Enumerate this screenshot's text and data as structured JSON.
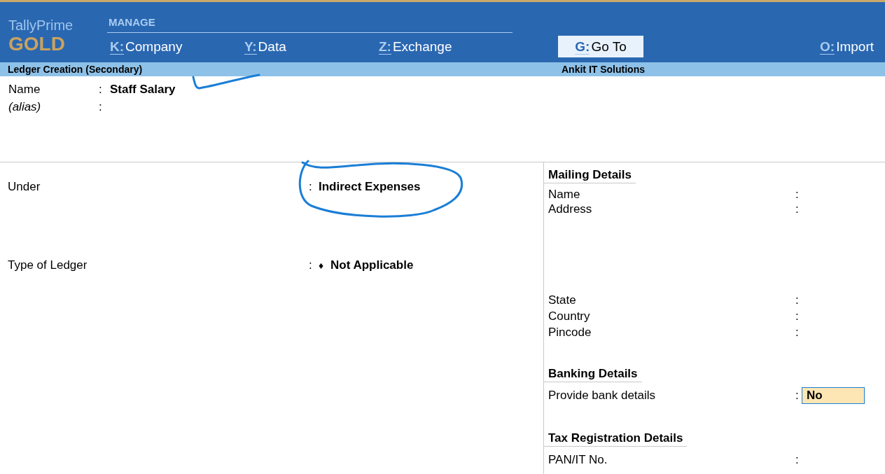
{
  "brand": {
    "product": "TallyPrime",
    "edition": "GOLD"
  },
  "menu": {
    "title": "MANAGE",
    "items": [
      {
        "key": "K:",
        "label": "Company",
        "selected": false
      },
      {
        "key": "Y:",
        "label": "Data",
        "selected": false
      },
      {
        "key": "Z:",
        "label": "Exchange",
        "selected": false
      },
      {
        "key": "G:",
        "label": "Go To",
        "selected": true
      },
      {
        "key": "O:",
        "label": "Import",
        "selected": false
      }
    ]
  },
  "subtitle_bar": {
    "screen": "Ledger Creation (Secondary)",
    "company": "Ankit IT Solutions"
  },
  "header_fields": [
    {
      "label": "Name",
      "italic": false,
      "separator": ":",
      "value": "Staff Salary"
    },
    {
      "label": "(alias)",
      "italic": true,
      "separator": ":"
    }
  ],
  "left_fields": [
    {
      "label": "Under",
      "separator": ":",
      "value": "Indirect Expenses"
    },
    {
      "label": "Type of Ledger",
      "separator": ":",
      "marker": "♦",
      "value": "Not Applicable"
    }
  ],
  "sections": [
    {
      "title": "Mailing Details",
      "fields": [
        {
          "kind": "line",
          "label": "Name",
          "separator": ":"
        },
        {
          "kind": "multiline",
          "label": "Address",
          "separator": ":"
        },
        {
          "kind": "line",
          "label": "State",
          "separator": ":"
        },
        {
          "kind": "line",
          "label": "Country",
          "separator": ":"
        },
        {
          "kind": "line",
          "label": "Pincode",
          "separator": ":"
        }
      ]
    },
    {
      "title": "Banking Details",
      "fields": [
        {
          "kind": "line",
          "label": "Provide bank details",
          "separator": ":",
          "value": "No",
          "focused": true
        }
      ]
    },
    {
      "title": "Tax Registration Details",
      "fields": [
        {
          "kind": "line",
          "label": "PAN/IT No.",
          "separator": ":"
        }
      ]
    }
  ]
}
